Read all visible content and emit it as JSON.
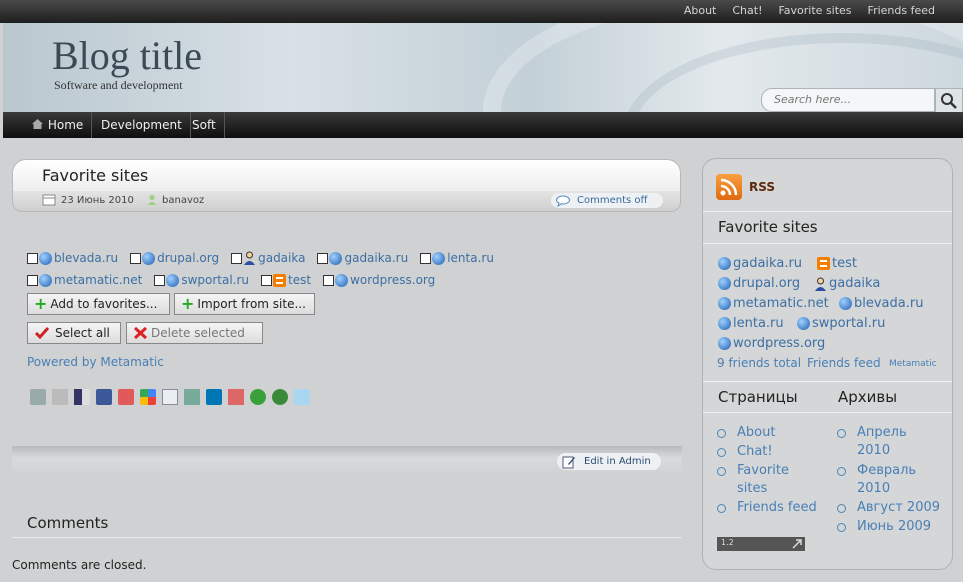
{
  "topbar": {
    "links": [
      "About",
      "Chat!",
      "Favorite sites",
      "Friends feed"
    ]
  },
  "header": {
    "title": "Blog title",
    "tagline": "Software and development",
    "search_placeholder": "Search here..."
  },
  "nav": {
    "items": [
      "Home",
      "Development",
      "Soft"
    ]
  },
  "post": {
    "title": "Favorite sites",
    "date": "23 Июнь 2010",
    "author": "banavoz",
    "comments_label": "Comments off",
    "sites_row1": [
      {
        "name": "blevada.ru",
        "icon": "globe-icon"
      },
      {
        "name": "drupal.org",
        "icon": "globe-icon"
      },
      {
        "name": "gadaika",
        "icon": "user-icon"
      },
      {
        "name": "gadaika.ru",
        "icon": "globe-icon"
      },
      {
        "name": "lenta.ru",
        "icon": "globe-icon"
      }
    ],
    "sites_row2": [
      {
        "name": "metamatic.net",
        "icon": "globe-icon"
      },
      {
        "name": "swportal.ru",
        "icon": "globe-icon"
      },
      {
        "name": "test",
        "icon": "blogger-icon"
      },
      {
        "name": "wordpress.org",
        "icon": "globe-icon"
      }
    ],
    "add_favorites": "Add to favorites...",
    "import_site": "Import from site...",
    "select_all": "Select all",
    "delete_selected": "Delete selected",
    "powered_by": "Powered by Metamatic",
    "edit_admin": "Edit in Admin",
    "comments_heading": "Comments",
    "comments_closed": "Comments are closed."
  },
  "sidebar": {
    "rss_label": "RSS",
    "favorites_heading": "Favorite sites",
    "favorites": [
      {
        "name": "gadaika.ru",
        "icon": "globe-icon"
      },
      {
        "name": "test",
        "icon": "blogger-icon"
      },
      {
        "name": "drupal.org",
        "icon": "globe-icon"
      },
      {
        "name": "gadaika",
        "icon": "user-icon"
      },
      {
        "name": "metamatic.net",
        "icon": "globe-icon"
      },
      {
        "name": "blevada.ru",
        "icon": "globe-icon"
      },
      {
        "name": "lenta.ru",
        "icon": "globe-icon"
      },
      {
        "name": "swportal.ru",
        "icon": "globe-icon"
      },
      {
        "name": "wordpress.org",
        "icon": "globe-icon"
      }
    ],
    "friends_total": "9 friends total",
    "friends_feed": "Friends feed",
    "metamatic": "Metamatic",
    "pages_heading": "Страницы",
    "pages": [
      "About",
      "Chat!",
      "Favorite sites",
      "Friends feed"
    ],
    "archives_heading": "Архивы",
    "archives": [
      "Апрель 2010",
      "Февраль 2010",
      "Август 2009",
      "Июнь 2009"
    ],
    "counter": "1.2"
  }
}
